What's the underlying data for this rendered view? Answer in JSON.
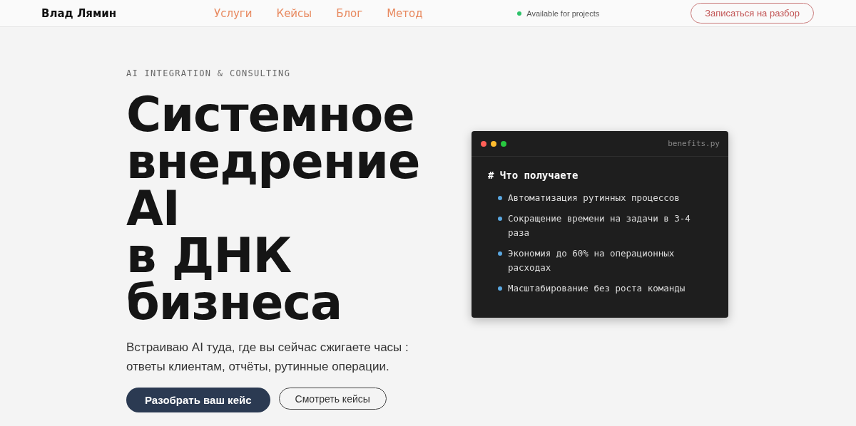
{
  "header": {
    "logo": "Влад Лямин",
    "nav": [
      {
        "label": "Услуги"
      },
      {
        "label": "Кейсы"
      },
      {
        "label": "Блог"
      },
      {
        "label": "Метод"
      }
    ],
    "status": "Available for projects",
    "cta": "Записаться на разбор"
  },
  "hero": {
    "eyebrow": "AI INTEGRATION & CONSULTING",
    "title_lines": [
      "Системное",
      "внедрение",
      "AI",
      "в ДНК",
      "бизнеса"
    ],
    "lead": "Встраиваю AI туда, где вы сейчас сжигаете часы : ответы клиентам, отчёты, рутинные операции.",
    "buttons": [
      {
        "label": "Разобрать ваш кейс",
        "kind": "primary"
      },
      {
        "label": "Смотреть кейсы",
        "kind": "secondary"
      }
    ]
  },
  "code_window": {
    "filename": "benefits.py",
    "heading": "# Что получаете",
    "items": [
      "Автоматизация рутинных процессов",
      "Сокращение времени на задачи в 3-4 раза",
      "Экономия до 60% на операционных расходах",
      "Масштабирование без роста команды"
    ]
  }
}
